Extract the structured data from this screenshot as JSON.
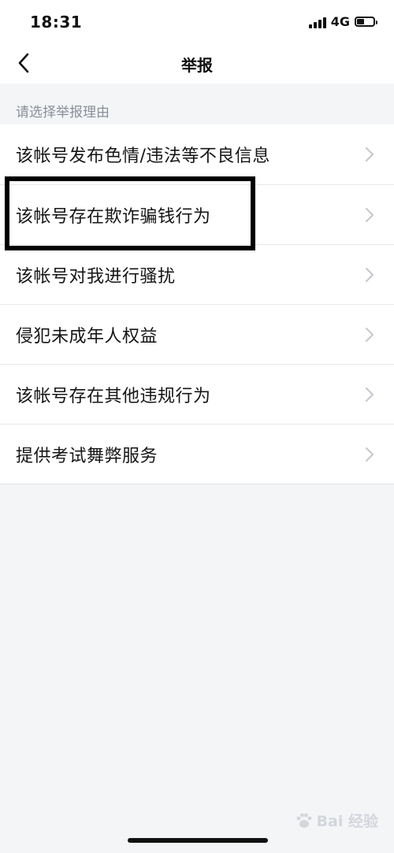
{
  "status_bar": {
    "time": "18:31",
    "network": "4G",
    "battery_level": 0.45
  },
  "nav": {
    "title": "举报",
    "back_icon": "chevron-left-icon"
  },
  "section": {
    "header": "请选择举报理由"
  },
  "reasons": [
    {
      "label": "该帐号发布色情/违法等不良信息"
    },
    {
      "label": "该帐号存在欺诈骗钱行为"
    },
    {
      "label": "该帐号对我进行骚扰"
    },
    {
      "label": "侵犯未成年人权益"
    },
    {
      "label": "该帐号存在其他违规行为"
    },
    {
      "label": "提供考试舞弊服务"
    }
  ],
  "watermark": {
    "text": "Bai 经验",
    "icon": "paw-icon"
  },
  "colors": {
    "background": "#f4f5f7",
    "list_background": "#ffffff",
    "divider": "#e6e7eb",
    "muted_text": "#8a8f99",
    "chevron": "#c4c7cc",
    "highlight": "#000000"
  }
}
